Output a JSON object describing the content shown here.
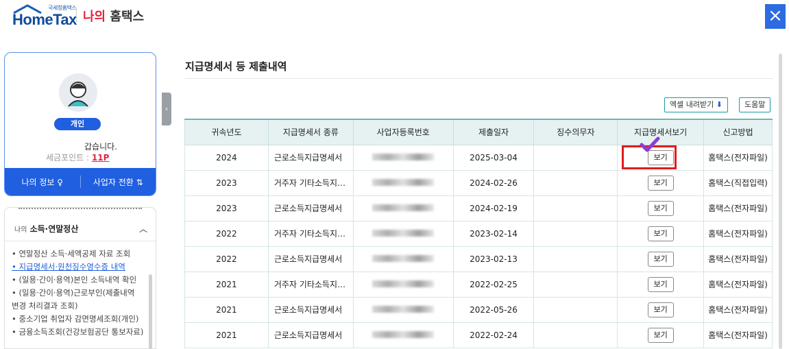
{
  "header": {
    "logo_small": "국세청홈택스",
    "logo_main": "HomeTax",
    "title_accent": "나의",
    "title_rest": " 홈택스",
    "close_icon": "close-icon"
  },
  "profile": {
    "badge": "개인",
    "greeting": "갑습니다.",
    "points_label": "세금포인트 : ",
    "points_value": "11P",
    "my_info": "나의 정보 ♀",
    "switch_biz": "사업자 전환 ⇅"
  },
  "menu": {
    "head_small": "나의",
    "head_bold": " 소득·연말정산",
    "items": [
      "• 연말정산 소득·세액공제 자료 조회",
      "• 지급명세서·원천징수영수증 내역",
      "• (일용·간이·용역)본인 소득내역 확인",
      "• (일용·간이·용역)근로부인(제출내역",
      "  변경 처리결과 조회)",
      "• 중소기업 취업자 감면명세조회(개인)",
      "• 금융소득조회(건강보험공단 통보자료)"
    ]
  },
  "main": {
    "title": "지급명세서 등 제출내역",
    "excel_btn": "엑셀 내려받기",
    "help_btn": "도움말",
    "columns": [
      "귀속년도",
      "지급명세서 종류",
      "사업자등록번호",
      "제출일자",
      "징수의무자",
      "지급명세서보기",
      "신고방법"
    ],
    "view_label": "보기",
    "rows": [
      {
        "year": "2024",
        "kind": "근로소득지급명세서",
        "date": "2025-03-04",
        "method": "홈택스(전자파일)"
      },
      {
        "year": "2023",
        "kind": "거주자 기타소득지…",
        "date": "2024-02-26",
        "method": "홈택스(직접입력)"
      },
      {
        "year": "2023",
        "kind": "근로소득지급명세서",
        "date": "2024-02-19",
        "method": "홈택스(전자파일)"
      },
      {
        "year": "2022",
        "kind": "거주자 기타소득지…",
        "date": "2023-02-14",
        "method": "홈택스(전자파일)"
      },
      {
        "year": "2022",
        "kind": "근로소득지급명세서",
        "date": "2023-02-13",
        "method": "홈택스(전자파일)"
      },
      {
        "year": "2021",
        "kind": "거주자 기타소득지…",
        "date": "2022-02-25",
        "method": "홈택스(전자파일)"
      },
      {
        "year": "2021",
        "kind": "근로소득지급명세서",
        "date": "2022-05-26",
        "method": "홈택스(전자파일)"
      },
      {
        "year": "2021",
        "kind": "근로소득지급명세서",
        "date": "2022-02-24",
        "method": "홈택스(전자파일)"
      }
    ]
  },
  "colors": {
    "brand": "#1f5fe0",
    "accent_red": "#e4233c",
    "table_head": "#e6f2f2",
    "highlight": "#e11b1b"
  }
}
